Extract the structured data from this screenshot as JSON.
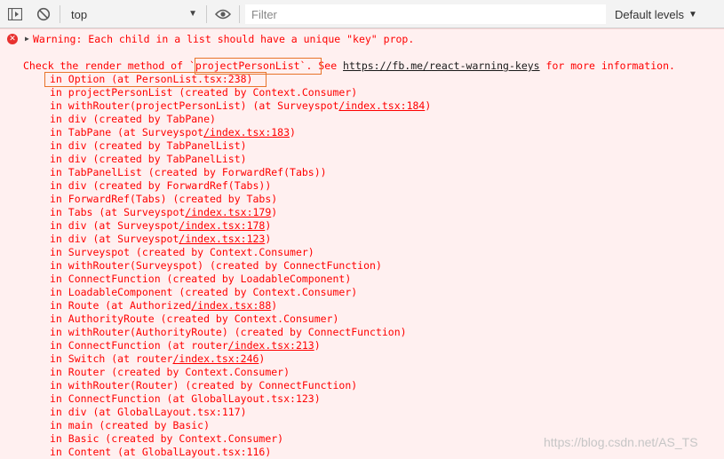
{
  "toolbar": {
    "context": "top",
    "filter_placeholder": "Filter",
    "levels_label": "Default levels"
  },
  "message": {
    "warning": "Warning: Each child in a list should have a unique \"key\" prop.",
    "check_prefix": "Check the render method of ",
    "check_component": "`projectPersonList`",
    "check_middle": ". See ",
    "check_link": "https://fb.me/react-warning-keys",
    "check_suffix": " for more information.",
    "stack": [
      {
        "pre": "in Option (at PersonList.tsx:238)",
        "link": "",
        "post": ""
      },
      {
        "pre": "in projectPersonList (created by Context.Consumer)",
        "link": "",
        "post": ""
      },
      {
        "pre": "in withRouter(projectPersonList) (at Surveyspot",
        "link": "/index.tsx:184",
        "post": ")"
      },
      {
        "pre": "in div (created by TabPane)",
        "link": "",
        "post": ""
      },
      {
        "pre": "in TabPane (at Surveyspot",
        "link": "/index.tsx:183",
        "post": ")"
      },
      {
        "pre": "in div (created by TabPanelList)",
        "link": "",
        "post": ""
      },
      {
        "pre": "in div (created by TabPanelList)",
        "link": "",
        "post": ""
      },
      {
        "pre": "in TabPanelList (created by ForwardRef(Tabs))",
        "link": "",
        "post": ""
      },
      {
        "pre": "in div (created by ForwardRef(Tabs))",
        "link": "",
        "post": ""
      },
      {
        "pre": "in ForwardRef(Tabs) (created by Tabs)",
        "link": "",
        "post": ""
      },
      {
        "pre": "in Tabs (at Surveyspot",
        "link": "/index.tsx:179",
        "post": ")"
      },
      {
        "pre": "in div (at Surveyspot",
        "link": "/index.tsx:178",
        "post": ")"
      },
      {
        "pre": "in div (at Surveyspot",
        "link": "/index.tsx:123",
        "post": ")"
      },
      {
        "pre": "in Surveyspot (created by Context.Consumer)",
        "link": "",
        "post": ""
      },
      {
        "pre": "in withRouter(Surveyspot) (created by ConnectFunction)",
        "link": "",
        "post": ""
      },
      {
        "pre": "in ConnectFunction (created by LoadableComponent)",
        "link": "",
        "post": ""
      },
      {
        "pre": "in LoadableComponent (created by Context.Consumer)",
        "link": "",
        "post": ""
      },
      {
        "pre": "in Route (at Authorized",
        "link": "/index.tsx:88",
        "post": ")"
      },
      {
        "pre": "in AuthorityRoute (created by Context.Consumer)",
        "link": "",
        "post": ""
      },
      {
        "pre": "in withRouter(AuthorityRoute) (created by ConnectFunction)",
        "link": "",
        "post": ""
      },
      {
        "pre": "in ConnectFunction (at router",
        "link": "/index.tsx:213",
        "post": ")"
      },
      {
        "pre": "in Switch (at router",
        "link": "/index.tsx:246",
        "post": ")"
      },
      {
        "pre": "in Router (created by Context.Consumer)",
        "link": "",
        "post": ""
      },
      {
        "pre": "in withRouter(Router) (created by ConnectFunction)",
        "link": "",
        "post": ""
      },
      {
        "pre": "in ConnectFunction (at GlobalLayout.tsx:123)",
        "link": "",
        "post": ""
      },
      {
        "pre": "in div (at GlobalLayout.tsx:117)",
        "link": "",
        "post": ""
      },
      {
        "pre": "in main (created by Basic)",
        "link": "",
        "post": ""
      },
      {
        "pre": "in Basic (created by Context.Consumer)",
        "link": "",
        "post": ""
      },
      {
        "pre": "in Content (at GlobalLayout.tsx:116)",
        "link": "",
        "post": ""
      }
    ]
  },
  "watermark": "https://blog.csdn.net/AS_TS"
}
